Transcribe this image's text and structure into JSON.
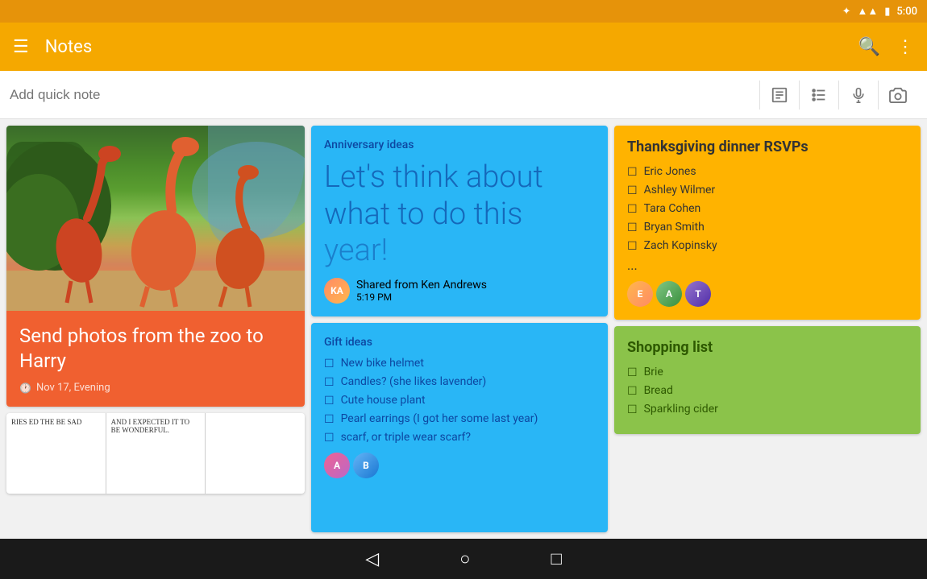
{
  "statusBar": {
    "time": "5:00",
    "bluetooth": "✦",
    "signal": "▲▲",
    "battery": "▮"
  },
  "toolbar": {
    "menu": "☰",
    "title": "Notes",
    "search": "🔍",
    "more": "⋮"
  },
  "searchBar": {
    "placeholder": "Add quick note",
    "textIcon": "▤",
    "listIcon": "≡",
    "micIcon": "🎤",
    "cameraIcon": "📷"
  },
  "cards": {
    "flamingo": {
      "title": "Send photos from the zoo to Harry",
      "time": "Nov 17, Evening"
    },
    "anniversary": {
      "label": "Anniversary ideas",
      "content": "Let's think about what to do this",
      "sharedFrom": "Shared from Ken Andrews",
      "time": "5:19 PM"
    },
    "gift": {
      "label": "Gift ideas",
      "items": [
        "New bike helmet",
        "Candles? (she likes lavender)",
        "Cute house plant",
        "Pearl earrings (I got her some last year)",
        "scarf, or triple wear scarf?"
      ]
    },
    "thanksgiving": {
      "title": "Thanksgiving dinner RSVPs",
      "items": [
        "Eric Jones",
        "Ashley Wilmer",
        "Tara Cohen",
        "Bryan Smith",
        "Zach Kopinsky",
        "..."
      ]
    },
    "shopping": {
      "title": "Shopping list",
      "items": [
        "Brie",
        "Bread",
        "Sparkling cider"
      ]
    }
  },
  "comic": {
    "panel1": "RIES ED THE BE SAD",
    "panel2": "AND I EXPECTED IT TO BE WONDERFUL.",
    "panel3": ""
  },
  "bottomNav": {
    "back": "◁",
    "home": "○",
    "recents": "□"
  }
}
